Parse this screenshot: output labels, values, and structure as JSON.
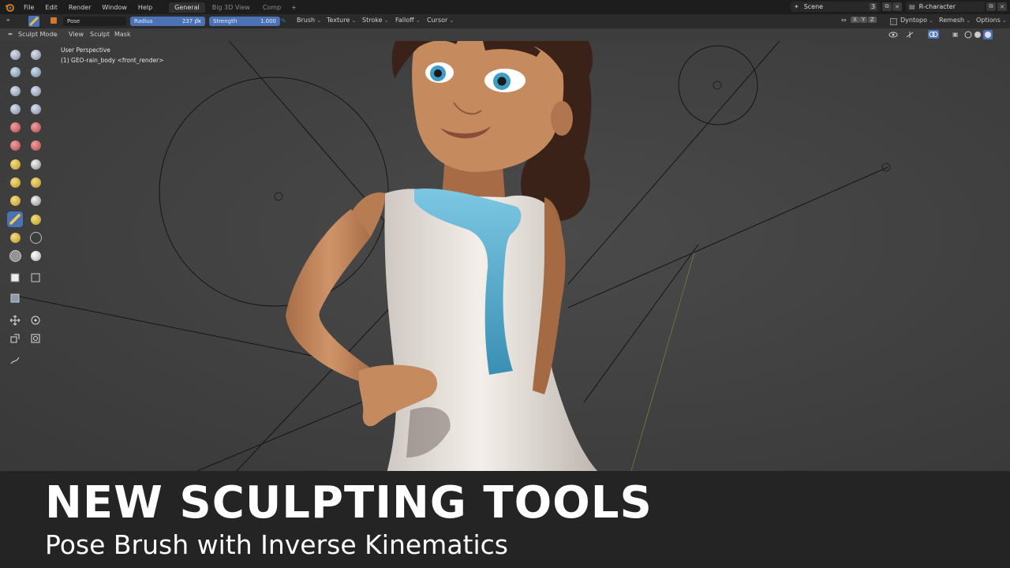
{
  "menu": {
    "file": "File",
    "edit": "Edit",
    "render": "Render",
    "window": "Window",
    "help": "Help"
  },
  "workspaces": [
    {
      "label": "General"
    },
    {
      "label": "Big 3D View"
    },
    {
      "label": "Comp"
    }
  ],
  "workspace_add": "+",
  "scene": {
    "name": "Scene",
    "count": "3",
    "view_layer": "R-character"
  },
  "tool_settings": {
    "brush_name": "Pose",
    "radius_label": "Radius",
    "radius_value": "237 px",
    "strength_label": "Strength",
    "strength_value": "1.000",
    "brush": "Brush",
    "texture": "Texture",
    "stroke": "Stroke",
    "falloff": "Falloff",
    "cursor": "Cursor"
  },
  "right_controls": {
    "x": "X",
    "y": "Y",
    "z": "Z",
    "dyntopo": "Dyntopo",
    "remesh": "Remesh",
    "options": "Options"
  },
  "header": {
    "mode": "Sculpt Mode",
    "view": "View",
    "sculpt": "Sculpt",
    "mask": "Mask"
  },
  "viewport": {
    "perspective": "User Perspective",
    "object": "(1) GEO-rain_body <front_render>"
  },
  "banner": {
    "title": "NEW SCULPTING TOOLS",
    "subtitle": "Pose Brush with Inverse Kinematics"
  },
  "colors": {
    "accent": "#4a72b4",
    "scarf": "#5aaed0",
    "skin": "#c58a5e",
    "top": "#efe9e3",
    "hair": "#3a2218"
  },
  "icons": [
    "blender-logo-icon",
    "draw-brush-icon",
    "pose-brush-icon",
    "move-icon",
    "rotate-icon",
    "scale-icon",
    "transform-icon",
    "annotate-icon"
  ]
}
